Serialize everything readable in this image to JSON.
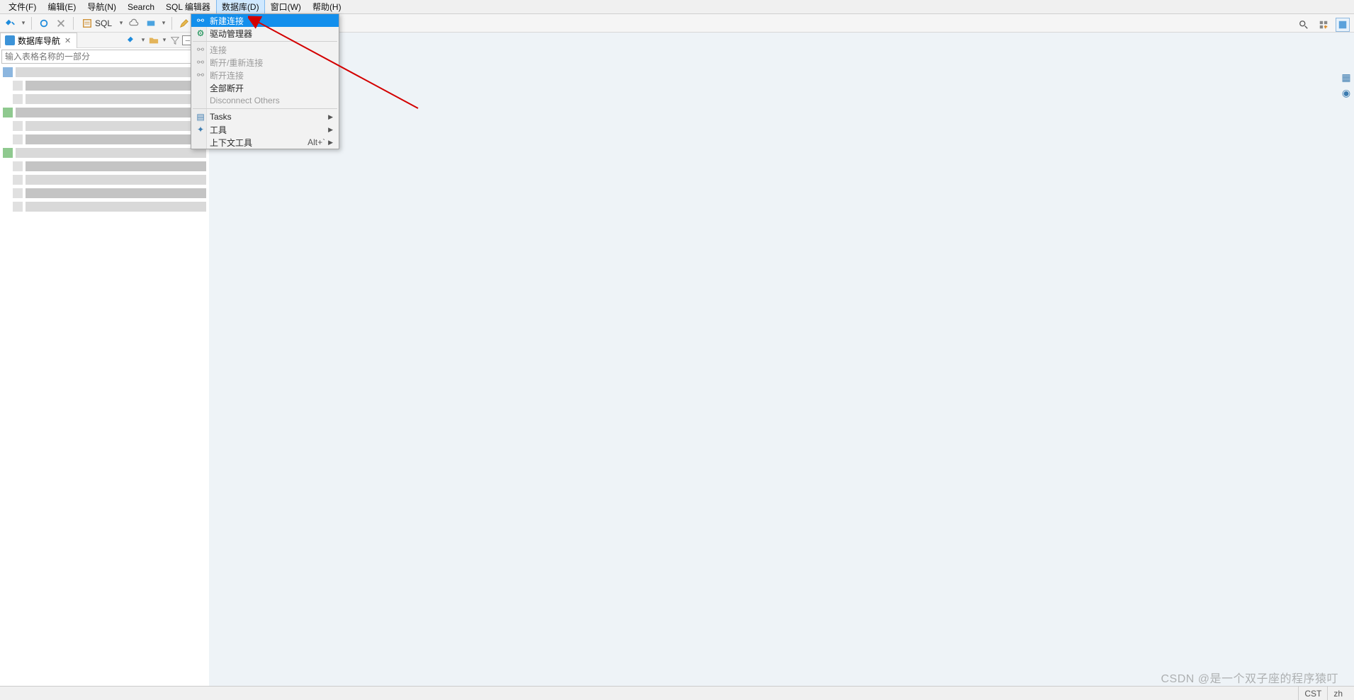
{
  "menu": {
    "items": [
      "文件(F)",
      "编辑(E)",
      "导航(N)",
      "Search",
      "SQL 编辑器",
      "数据库(D)",
      "窗口(W)",
      "帮助(H)"
    ],
    "active_index": 5
  },
  "toolbar": {
    "sql_label": "SQL"
  },
  "sidebar": {
    "tab_title": "数据库导航",
    "search_placeholder": "输入表格名称的一部分"
  },
  "dropdown": {
    "items": [
      {
        "label": "新建连接",
        "icon": "plug",
        "highlight": true
      },
      {
        "label": "驱动管理器",
        "icon": "driver"
      },
      {
        "sep": true
      },
      {
        "label": "连接",
        "icon": "plug-grey",
        "disabled": true
      },
      {
        "label": "断开/重新连接",
        "icon": "plug-grey",
        "disabled": true
      },
      {
        "label": "断开连接",
        "icon": "plug-grey",
        "disabled": true
      },
      {
        "label": "全部断开"
      },
      {
        "label": "Disconnect Others",
        "disabled": true
      },
      {
        "sep": true
      },
      {
        "label": "Tasks",
        "icon": "tasks",
        "submenu": true
      },
      {
        "label": "工具",
        "icon": "tools",
        "submenu": true
      },
      {
        "label": "上下文工具",
        "shortcut": "Alt+`",
        "submenu": true
      }
    ]
  },
  "status": {
    "tz": "CST",
    "lang": "zh"
  },
  "watermark": "CSDN @是一个双子座的程序猿叮"
}
